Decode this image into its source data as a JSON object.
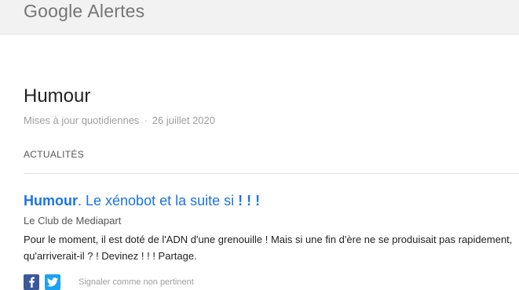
{
  "header": {
    "brand": "Google",
    "product": "Alertes"
  },
  "alert": {
    "title": "Humour",
    "frequency": "Mises à jour quotidiennes",
    "separator": "·",
    "date": "26 juillet 2020"
  },
  "section": {
    "label": "ACTUALITÉS"
  },
  "article": {
    "title_bold": "Humour",
    "title_rest": ". Le xénobot et la suite si ",
    "title_bold_end": "! ! !",
    "source": "Le Club de Mediapart",
    "snippet": "Pour le moment, il est doté de l'ADN d'une grenouille ! Mais si une fin d'ère ne se produisait pas rapidement, qu'arriverait-il ? ! Devinez ! ! ! Partage.",
    "report_label": "Signaler comme non pertinent"
  },
  "icons": {
    "facebook": "facebook-icon",
    "twitter": "twitter-icon"
  },
  "colors": {
    "link": "#1a73e8",
    "facebook": "#3b5998",
    "twitter": "#1da1f2",
    "muted": "#9e9e9e"
  }
}
